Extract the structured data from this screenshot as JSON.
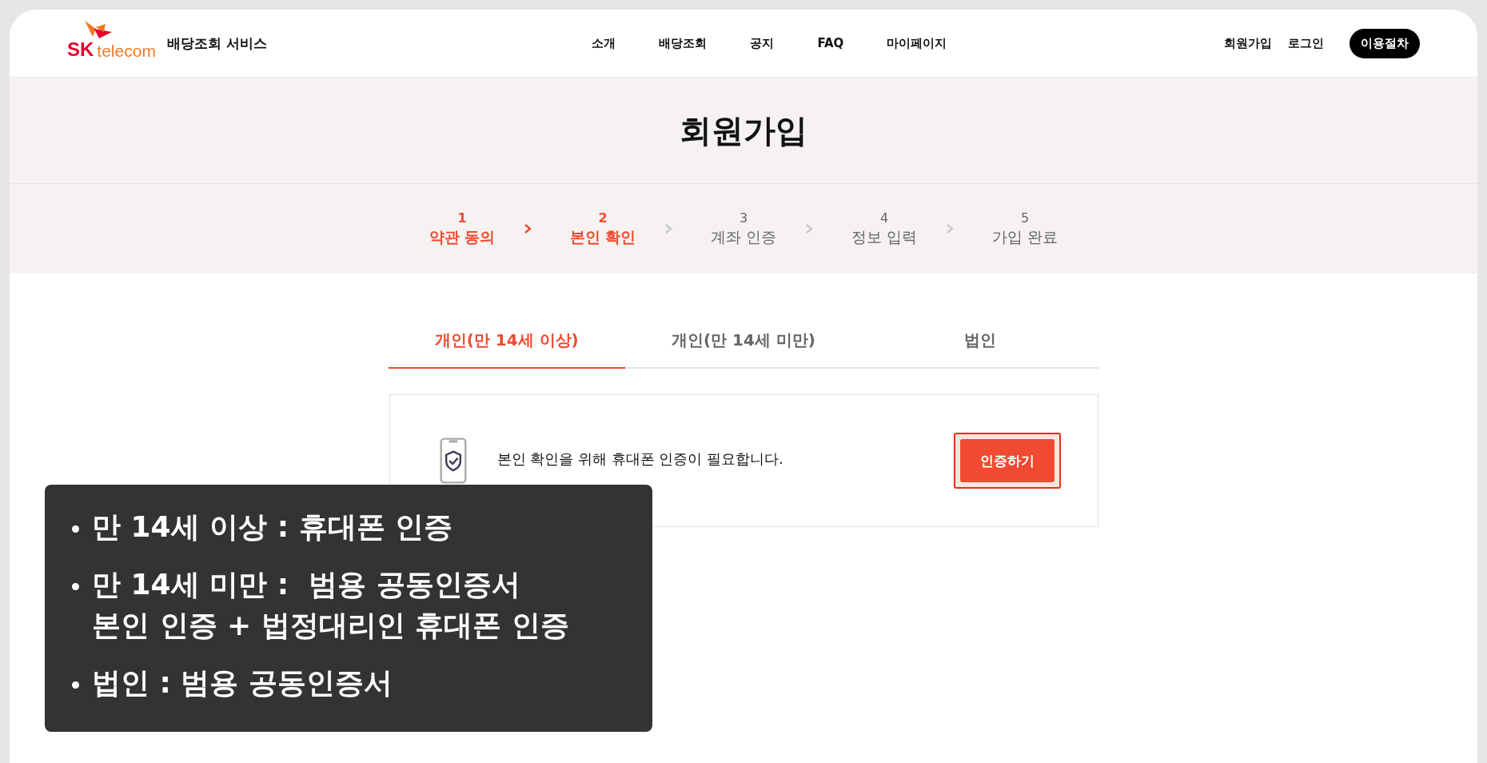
{
  "header": {
    "logo": {
      "brand": "SK",
      "sub": "telecom"
    },
    "service_name": "배당조회 서비스",
    "nav": [
      "소개",
      "배당조회",
      "공지",
      "FAQ",
      "마이페이지"
    ],
    "links": [
      "회원가입",
      "로그인"
    ],
    "cta": "이용절차"
  },
  "page_title": "회원가입",
  "steps": [
    {
      "number": "1",
      "label": "약관 동의",
      "active": true
    },
    {
      "number": "2",
      "label": "본인 확인",
      "active": true
    },
    {
      "number": "3",
      "label": "계좌 인증",
      "active": false
    },
    {
      "number": "4",
      "label": "정보 입력",
      "active": false
    },
    {
      "number": "5",
      "label": "가입 완료",
      "active": false
    }
  ],
  "tabs": [
    {
      "label": "개인(만 14세 이상)",
      "selected": true
    },
    {
      "label": "개인(만 14세 미만)",
      "selected": false
    },
    {
      "label": "법인",
      "selected": false
    }
  ],
  "card": {
    "message": "본인 확인을 위해 휴대폰 인증이 필요합니다.",
    "button": "인증하기"
  },
  "callout": {
    "items": [
      "만 14세 이상 : 휴대폰 인증",
      "만 14세 미만 :  범용 공동인증서\n본인 인증 + 법정대리인 휴대폰 인증",
      "법인 : 범용 공동인증서"
    ]
  }
}
